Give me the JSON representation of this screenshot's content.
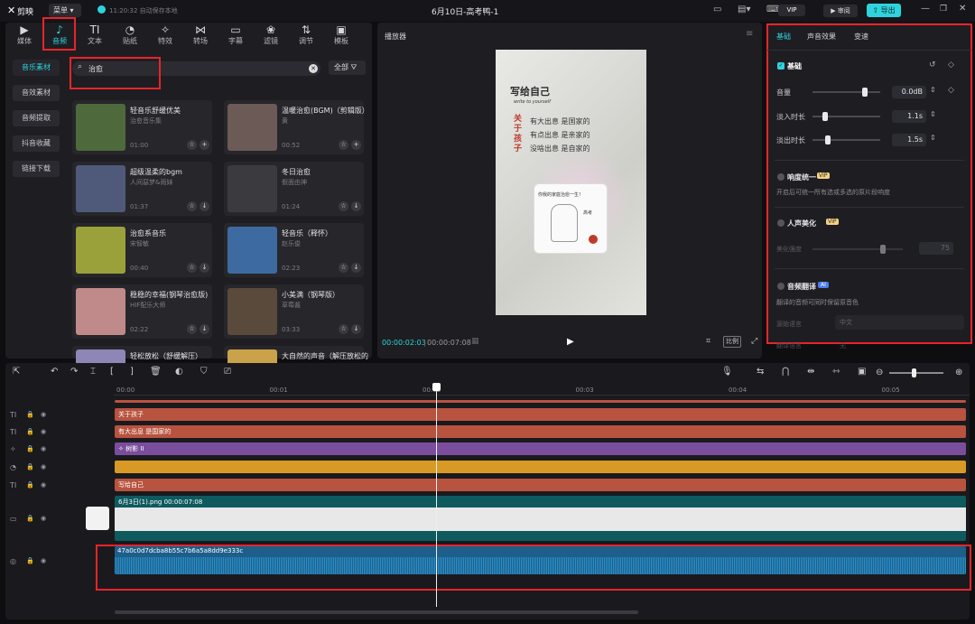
{
  "titlebar": {
    "app_name": "剪映",
    "menu_label": "菜单",
    "autosave": "11:20:32 自动保存本地",
    "project_title": "6月10日-高考鸭-1",
    "vip": "VIP",
    "review": "审阅",
    "export": "导出"
  },
  "tabs": [
    {
      "label": "媒体",
      "icon": "▶"
    },
    {
      "label": "音频",
      "icon": "♪"
    },
    {
      "label": "文本",
      "icon": "TI"
    },
    {
      "label": "贴纸",
      "icon": "◔"
    },
    {
      "label": "特效",
      "icon": "✧"
    },
    {
      "label": "转场",
      "icon": "⋈"
    },
    {
      "label": "字幕",
      "icon": "▭"
    },
    {
      "label": "滤镜",
      "icon": "❀"
    },
    {
      "label": "调节",
      "icon": "⇅"
    },
    {
      "label": "模板",
      "icon": "▣"
    }
  ],
  "sidebar": [
    "音乐素材",
    "音效素材",
    "音频提取",
    "抖音收藏",
    "链接下载"
  ],
  "search": {
    "value": "治愈",
    "filter_label": "全部"
  },
  "cards": [
    {
      "title": "轻音乐舒缓优美",
      "sub": "治愈音乐集",
      "dur": "01:00",
      "color": "#4e6a3c"
    },
    {
      "title": "温暖治愈(BGM)（剪辑版）",
      "sub": "黄",
      "dur": "00:52",
      "color": "#6b5a56"
    },
    {
      "title": "超级温柔的bgm",
      "sub": "人间惡梦&雨妹",
      "dur": "01:37",
      "color": "#4f5a7a"
    },
    {
      "title": "冬日治愈",
      "sub": "假面由神",
      "dur": "01:24",
      "color": "#3b3b3f"
    },
    {
      "title": "治愈系音乐",
      "sub": "宋智敏",
      "dur": "00:40",
      "color": "#9aa03a"
    },
    {
      "title": "轻音乐（释怀）",
      "sub": "赵乐俊",
      "dur": "02:23",
      "color": "#3d6aa0"
    },
    {
      "title": "稳稳的幸福(钢琴治愈版)",
      "sub": "HIF配乐大师",
      "dur": "02:22",
      "color": "#c08a8a"
    },
    {
      "title": "小美满（钢琴版）",
      "sub": "草莓酱",
      "dur": "03:33",
      "color": "#5a4a3c"
    },
    {
      "title": "轻松放松（舒缓解压）",
      "sub": "",
      "dur": "",
      "color": "#8d86b6"
    },
    {
      "title": "大自然的声音（解压放松的",
      "sub": "",
      "dur": "",
      "color": "#c9a24a"
    }
  ],
  "player": {
    "title": "播放器",
    "current": "00:00:02:03",
    "total": "00:00:07:08",
    "ratio": "比例"
  },
  "video": {
    "line1": "写给自己",
    "line1_sub": "write to yourself",
    "vert": "关于孩子",
    "l2": "有大出息  是国家的",
    "l3": "有点出息  是亲家的",
    "l4": "没啥出息  是自家的",
    "card_text": "你我的家庭治愈一生！",
    "card_sub": "高考"
  },
  "props": {
    "tabs": [
      "基础",
      "声音效果",
      "变速"
    ],
    "basic": "基础",
    "volume_label": "音量",
    "volume": "0.0dB",
    "fadein_label": "淡入时长",
    "fadein": "1.1s",
    "fadeout_label": "淡出时长",
    "fadeout": "1.5s",
    "loud_label": "响度统一",
    "loud_desc": "开启后可统一所有选或多选的原片段响度",
    "vip": "VIP",
    "voice_label": "人声美化",
    "voice_strength": "美化强度",
    "voice_val": "75",
    "translate_label": "音频翻译",
    "ai": "AI",
    "translate_desc": "翻译的音频可同时保留原音色",
    "src_lang_label": "源始语言",
    "src_lang": "中文",
    "dst_lang_label": "翻译语言",
    "dst_lang": "无"
  },
  "timeline": {
    "ticks": [
      "00:00",
      "00:01",
      "00:02",
      "00:03",
      "00:04",
      "00:05"
    ],
    "clips": {
      "t1": "关于孩子",
      "t2": "有大出息 是国家的",
      "t3": "树影 II",
      "t5": "写给自己",
      "video": "6月3日(1).png  00:00:07:08",
      "audio": "47a0c0d7dcba8b55c7b6a5a8dd9e333c"
    }
  },
  "colors": {
    "accent": "#2fd3dd",
    "text_clip": "#b8533f",
    "effect_clip": "#7a4e9c",
    "adjust_clip": "#d99a25",
    "video_clip": "#0e5a5e",
    "audio_clip": "#1d5f8a"
  }
}
